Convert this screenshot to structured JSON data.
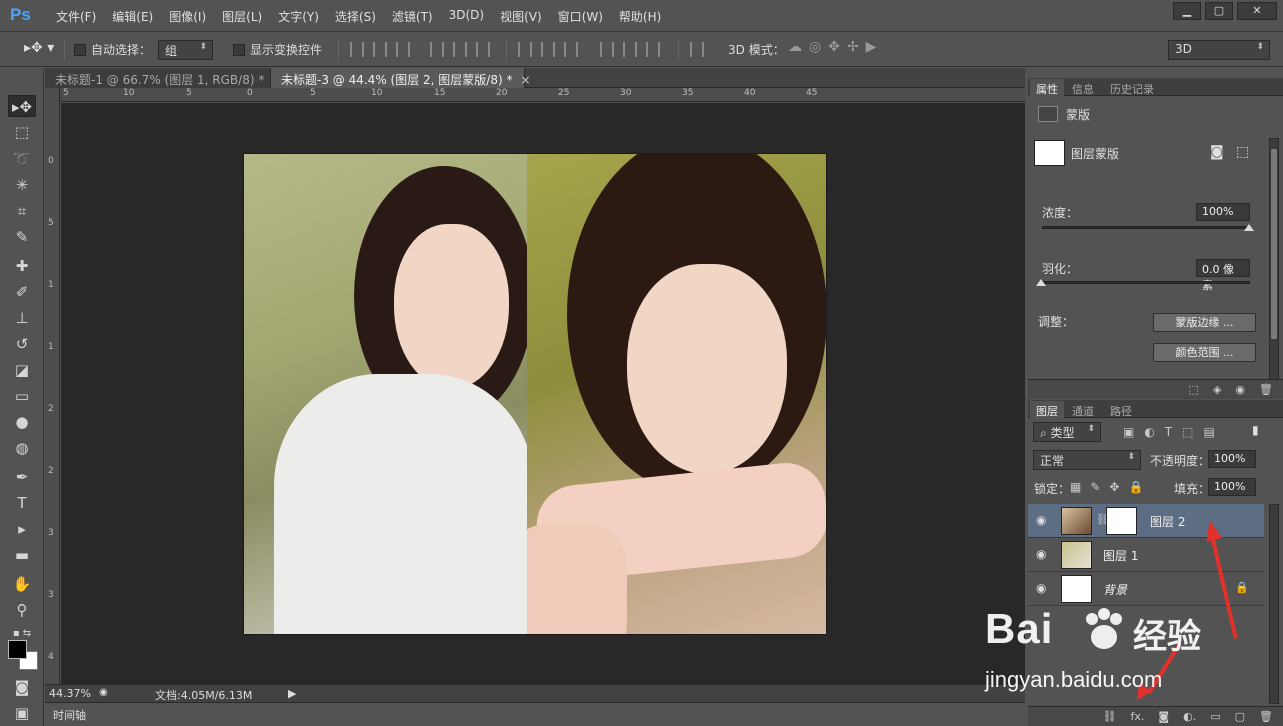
{
  "app": {
    "logo": "Ps",
    "menu": [
      "文件(F)",
      "编辑(E)",
      "图像(I)",
      "图层(L)",
      "文字(Y)",
      "选择(S)",
      "滤镜(T)",
      "3D(D)",
      "视图(V)",
      "窗口(W)",
      "帮助(H)"
    ],
    "window_controls": [
      "minimize-icon",
      "restore-icon",
      "close-icon"
    ]
  },
  "options": {
    "auto_select_label": "自动选择：",
    "auto_select_value": "组",
    "show_transform_label": "显示变换控件",
    "mode_3d_label": "3D 模式：",
    "workspace_value": "3D"
  },
  "tabs": [
    {
      "label": "未标题-1 @ 66.7% (图层 1, RGB/8) *",
      "close": "×"
    },
    {
      "label": "未标题-3 @ 44.4% (图层 2, 图层蒙版/8) *",
      "close": "×"
    }
  ],
  "ruler": {
    "h_labels": [
      "5",
      "10",
      "5",
      "0",
      "5",
      "10",
      "15",
      "20",
      "25",
      "30",
      "35",
      "40",
      "45"
    ],
    "v_labels": [
      "0",
      "5",
      "1",
      "1",
      "2",
      "2",
      "3",
      "3",
      "4"
    ]
  },
  "status": {
    "zoom": "44.37%",
    "doc": "文档:4.05M/6.13M",
    "timeline": "时间轴"
  },
  "properties": {
    "tabs": [
      "属性",
      "信息",
      "历史记录"
    ],
    "header": "蒙版",
    "mask_name": "图层蒙版",
    "density_label": "浓度：",
    "density_value": "100%",
    "feather_label": "羽化：",
    "feather_value": "0.0 像素",
    "adjust_label": "调整：",
    "mask_edge_button": "蒙版边缘 ...",
    "color_range_button": "颜色范围 ..."
  },
  "layers": {
    "tabs": [
      "图层",
      "通道",
      "路径"
    ],
    "filter_value": "类型",
    "blend_mode": "正常",
    "opacity_label": "不透明度：",
    "opacity_value": "100%",
    "lock_label": "锁定：",
    "fill_label": "填充：",
    "fill_value": "100%",
    "items": [
      {
        "name": "图层 2",
        "selected": true
      },
      {
        "name": "图层 1",
        "selected": false
      },
      {
        "name": "背景",
        "selected": false
      }
    ]
  },
  "watermark": {
    "brand": "Bai",
    "brand_cn": "经验",
    "url": "jingyan.baidu.com"
  },
  "colors": {
    "accent": "#4aa3ff",
    "selected_layer": "#5c6d84",
    "arrow": "#e3302a"
  }
}
